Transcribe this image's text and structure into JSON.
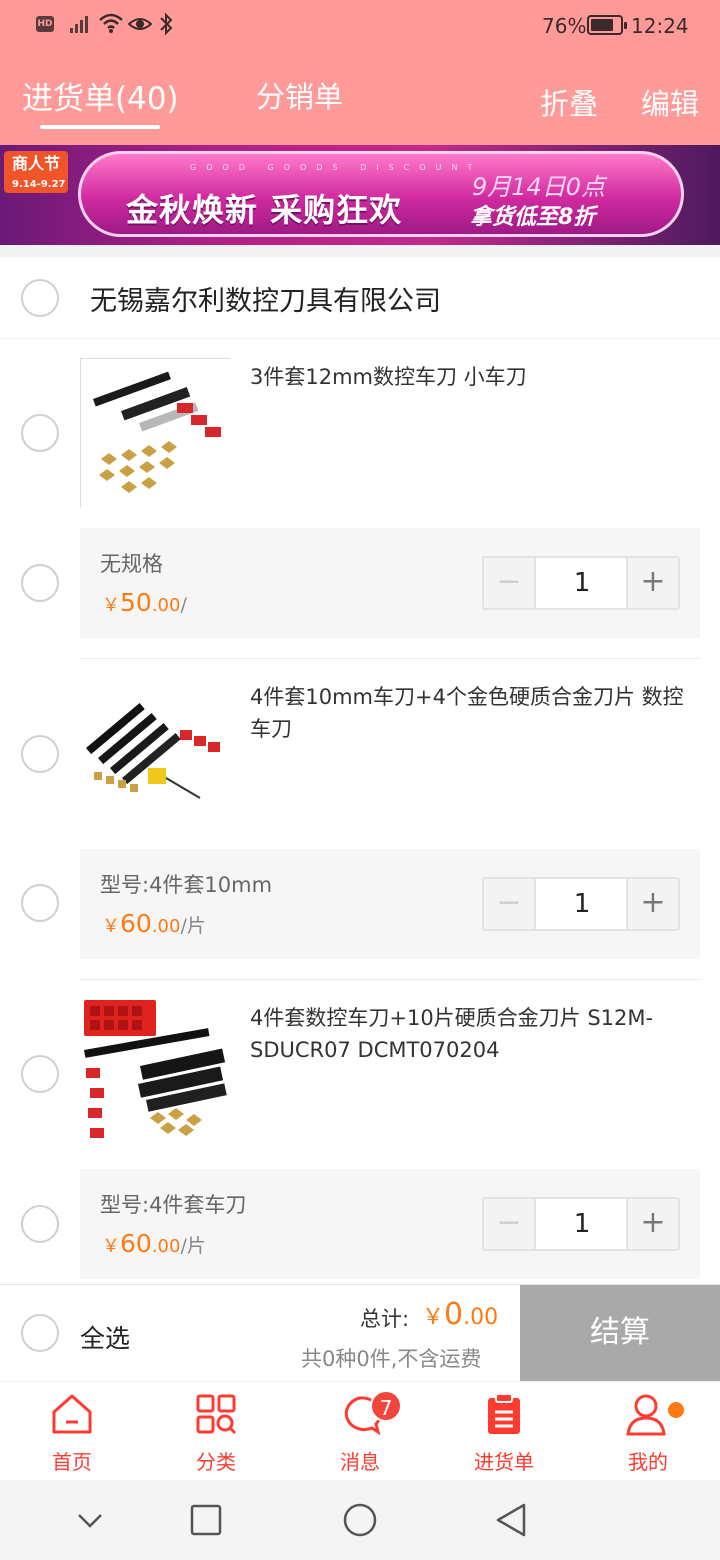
{
  "status": {
    "hd": "HD",
    "battery": "76%",
    "time": "12:24"
  },
  "header": {
    "tab_purchase": "进货单(40)",
    "tab_distribution": "分销单",
    "fold": "折叠",
    "edit": "编辑"
  },
  "banner": {
    "tag": "商人节",
    "tag_dates": "9.14-9.27",
    "slogan": "金秋焕新 采购狂欢",
    "date": "9月14日0点",
    "discount": "拿货低至8折",
    "tiny": "GOOD GOODS DISCOUNT"
  },
  "shop": {
    "name": "无锡嘉尔利数控刀具有限公司"
  },
  "products": [
    {
      "title": "3件套12mm数控车刀 小车刀",
      "spec": "无规格",
      "price_int": "50",
      "price_dec": ".00",
      "unit": "/",
      "qty": "1"
    },
    {
      "title": "4件套10mm车刀+4个金色硬质合金刀片 数控车刀",
      "spec": "型号:4件套10mm",
      "price_int": "60",
      "price_dec": ".00",
      "unit": "/片",
      "qty": "1"
    },
    {
      "title": "4件套数控车刀+10片硬质合金刀片 S12M-SDUCR07 DCMT070204",
      "spec": "型号:4件套车刀",
      "price_int": "60",
      "price_dec": ".00",
      "unit": "/片",
      "qty": "1"
    }
  ],
  "currency": "￥",
  "stepper": {
    "minus": "−",
    "plus": "+"
  },
  "checkout": {
    "select_all": "全选",
    "total_label": "总计:",
    "total_int": "0",
    "total_dec": ".00",
    "summary": "共0种0件,不含运费",
    "button": "结算"
  },
  "nav": {
    "items": [
      {
        "label": "首页",
        "icon": "home-icon"
      },
      {
        "label": "分类",
        "icon": "category-icon"
      },
      {
        "label": "消息",
        "icon": "message-icon",
        "badge": "7"
      },
      {
        "label": "进货单",
        "icon": "purchase-list-icon"
      },
      {
        "label": "我的",
        "icon": "profile-icon"
      }
    ]
  },
  "colors": {
    "header": "#ff9a99",
    "accent": "#ff3b30",
    "price": "#ff7a12",
    "checkout_disabled": "#a9a9a9"
  }
}
